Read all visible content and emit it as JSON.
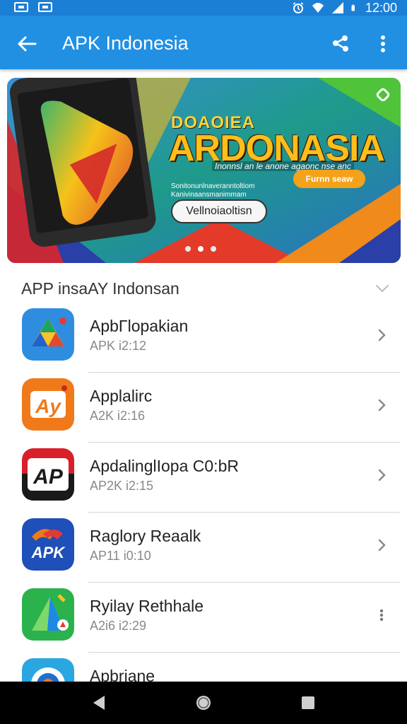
{
  "status_bar": {
    "time": "12:00"
  },
  "app_bar": {
    "title": "APK Indonesia"
  },
  "banner": {
    "headline_small": "DOAOIEA",
    "headline": "ARDONASIA",
    "subline": "Inonnsl an le anone agaonc nse anc",
    "tagline": "Sonitonunlnaveranntoltiom Kanivinaansmanimmam",
    "chip": "Furnn seaw",
    "cta": "Vellnoiaoltisn",
    "page_count": 3,
    "active_page": 2
  },
  "section": {
    "title": "APP insaAY Indonsan"
  },
  "apps": [
    {
      "name": "ApbΓlopakian",
      "meta": "APK i2:12",
      "action": "chevron",
      "icon": "drive-triangle-icon"
    },
    {
      "name": "Applalirc",
      "meta": "A2K i2:16",
      "action": "chevron",
      "icon": "ay-letters-icon"
    },
    {
      "name": "ApdalinglIopa C0:bR",
      "meta": "AP2K i2:15",
      "action": "chevron",
      "icon": "ap-letters-icon"
    },
    {
      "name": "Raglory Reaalk",
      "meta": "AP11 i0:10",
      "action": "chevron",
      "icon": "apk-badge-icon"
    },
    {
      "name": "Ryilay Rethhale",
      "meta": "A2i6 i2:29",
      "action": "more",
      "icon": "play-triangle-icon"
    },
    {
      "name": "Apbriane",
      "meta": "",
      "action": "more",
      "icon": "target-icon"
    }
  ],
  "colors": {
    "status_bar": "#1c7fd6",
    "app_bar": "#2190e3",
    "banner_accent": "#ffbe1a"
  }
}
